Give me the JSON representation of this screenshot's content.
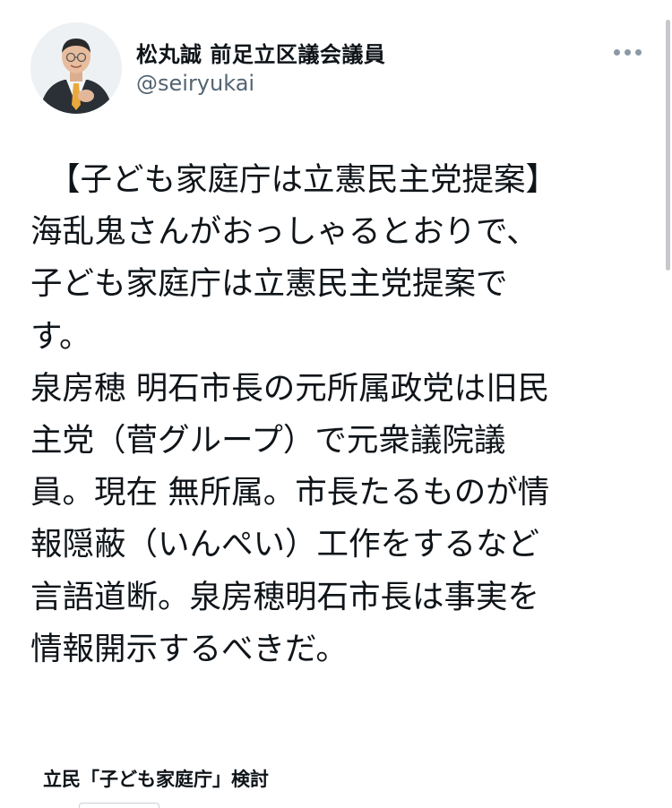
{
  "tweet": {
    "display_name": "松丸誠 前足立区議会議員",
    "handle": "@seiryukai",
    "avatar_icon": "person-portrait-icon",
    "more_icon": "more-horizontal-icon",
    "body_lines": [
      "【子ども家庭庁は立憲民主党提案】",
      "海乱鬼さんがおっしゃるとおりで、",
      "子ども家庭庁は立憲民主党提案で",
      "す。",
      "泉房穂 明石市長の元所属政党は旧民",
      "主党（菅グループ）で元衆議院議",
      "員。現在 無所属。市長たるものが情",
      "報隠蔽（いんぺい）工作をするなど",
      "言語道断。泉房穂明石市長は事実を",
      "情報開示するべきだ。"
    ]
  },
  "quoted_article": {
    "title": "立民「子ども家庭庁」検討"
  },
  "colors": {
    "text": "#0f1419",
    "secondary": "#536471",
    "icon": "#8b98a5"
  }
}
